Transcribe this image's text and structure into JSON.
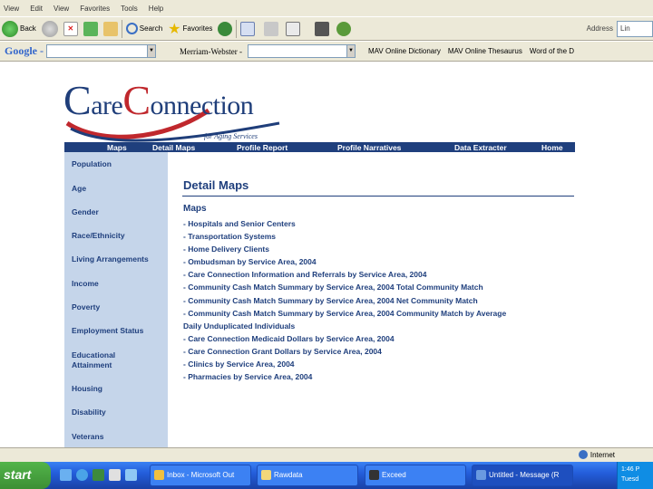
{
  "browser": {
    "menu": [
      "View",
      "Edit",
      "View",
      "Favorites",
      "Tools",
      "Help"
    ],
    "toolbar": {
      "back_label": "Back",
      "search_label": "Search",
      "favorites_label": "Favorites",
      "address_label": "Address",
      "address_value": "Lin"
    },
    "google_bar": {
      "google_label": "Google -",
      "google_value": "",
      "merriam_label": "Merriam-Webster -",
      "merriam_value": "",
      "links": [
        "MAV Online Dictionary",
        "MAV Online Thesaurus",
        "Word of the D"
      ]
    },
    "status": {
      "zone": "Internet"
    }
  },
  "site": {
    "logo": {
      "care": "are",
      "connection": "onnection",
      "tagline": "for Aging Services"
    },
    "nav": [
      "Maps",
      "Detail Maps",
      "Profile Report",
      "Profile Narratives",
      "Data Extracter",
      "Home"
    ],
    "sidebar": [
      "Population",
      "Age",
      "Gender",
      "Race/Ethnicity",
      "Living Arrangements",
      "Income",
      "Poverty",
      "Employment Status",
      "Educational",
      "Attainment",
      "Housing",
      "Disability",
      "Veterans"
    ],
    "page_title": "Detail Maps",
    "section_title": "Maps",
    "maps": [
      "- Hospitals and Senior Centers",
      "- Transportation Systems",
      "- Home Delivery Clients",
      "- Ombudsman by Service Area, 2004",
      "- Care Connection Information and Referrals by Service Area, 2004",
      "- Community Cash Match Summary by Service Area, 2004 Total Community Match",
      "- Community Cash Match Summary by Service Area, 2004 Net Community Match",
      "- Community Cash Match Summary by Service Area, 2004 Community Match by Average",
      "Daily Unduplicated Individuals",
      "- Care Connection Medicaid Dollars by Service Area, 2004",
      "- Care Connection Grant Dollars by Service Area, 2004",
      "- Clinics by Service Area, 2004",
      "- Pharmacies by Service Area, 2004"
    ]
  },
  "taskbar": {
    "start": "start",
    "tasks": [
      "Inbox - Microsoft Out",
      "Rawdata",
      "Exceed",
      "Untitled - Message (R"
    ],
    "clock": [
      "1:46 P",
      "Tuesd"
    ]
  },
  "colors": {
    "navy": "#1f3f7d",
    "sidebar": "#c5d5ea",
    "swoosh_red": "#c0282d"
  }
}
